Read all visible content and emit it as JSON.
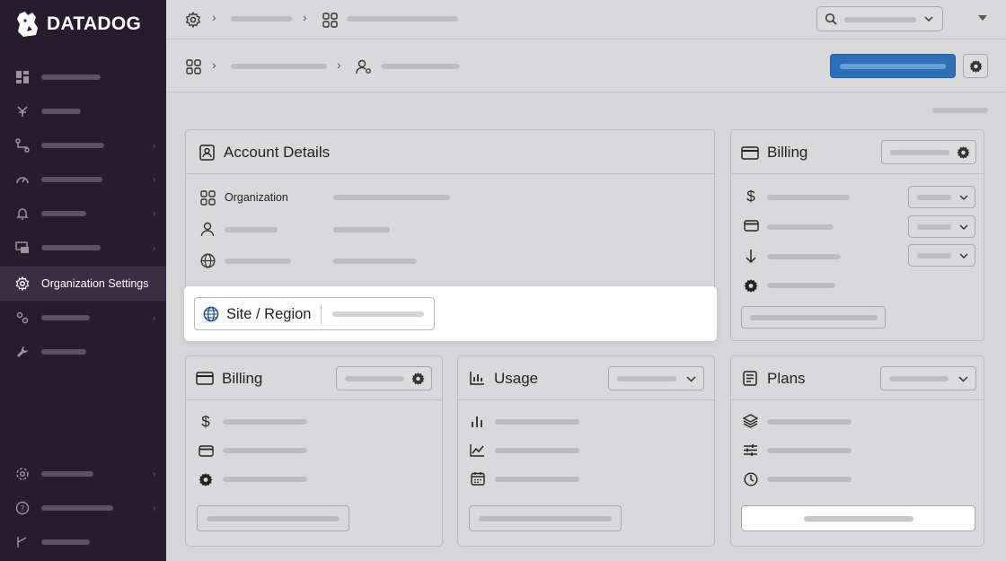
{
  "brand": {
    "name": "DATADOG"
  },
  "sidebar": {
    "active_label": "Organization Settings"
  },
  "account_details": {
    "title": "Account Details",
    "organization_label": "Organization"
  },
  "site_region": {
    "label": "Site / Region"
  },
  "billing_side": {
    "title": "Billing"
  },
  "billing": {
    "title": "Billing"
  },
  "usage": {
    "title": "Usage"
  },
  "plans": {
    "title": "Plans"
  },
  "colors": {
    "sidebar_bg": "#271c2e",
    "primary": "#2e6fb8",
    "page_bg": "#d7d7d9"
  }
}
